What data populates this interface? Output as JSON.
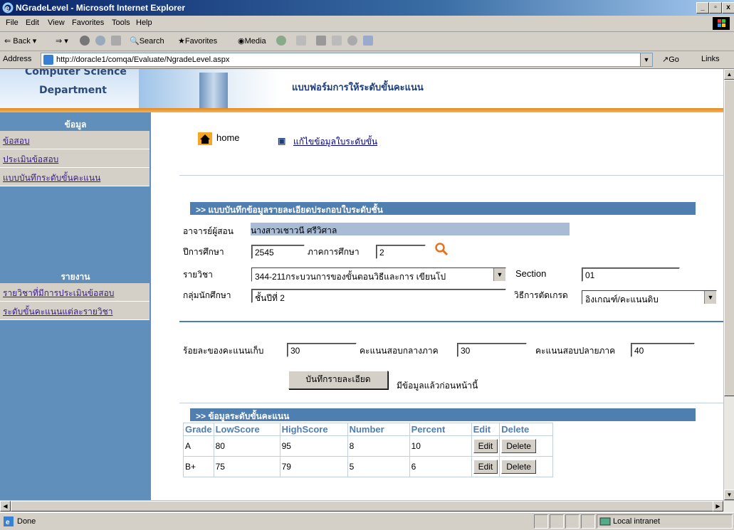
{
  "window": {
    "title": "NGradeLevel - Microsoft Internet Explorer"
  },
  "menu": [
    "File",
    "Edit",
    "View",
    "Favorites",
    "Tools",
    "Help"
  ],
  "toolbar": {
    "back": "Back",
    "search": "Search",
    "favorites": "Favorites",
    "media": "Media"
  },
  "address": {
    "label": "Address",
    "url": "http://doracle1/comqa/Evaluate/NgradeLevel.aspx",
    "go": "Go",
    "links": "Links"
  },
  "header": {
    "dept_line1": "Computer Science",
    "dept_line2": "Department",
    "title": "แบบฟอร์มการให้ระดับขั้นคะแนน"
  },
  "nav": {
    "section1": "ข้อมูล",
    "items1": [
      "ข้อสอบ",
      "ประเมินข้อสอบ",
      "แบบบันทึกระดับขั้นคะแนน"
    ],
    "section2": "รายงาน",
    "items2": [
      "รายวิชาที่มีการประเมินข้อสอบ",
      "ระดับขั้นคะแนนแต่ละรายวิชา"
    ]
  },
  "main": {
    "home": "home",
    "edit_link": "แก้ไขข้อมูลใบระดับขั้น",
    "section1_title": ">> แบบบันทึกข้อมูลรายละเอียดประกอบใบระดับชั้น",
    "teacher_label": "อาจารย์ผู้สอน",
    "teacher_value": "นางสาวเชาวนี ศรีวิศาล",
    "year_label": "ปีการศึกษา",
    "year_value": "2545",
    "term_label": "ภาคการศึกษา",
    "term_value": "2",
    "course_label": "รายวิชา",
    "course_value": "344-211กระบวนการของขั้นตอนวิธีและการ เขียนโป",
    "section_label": "Section",
    "section_value": "01",
    "group_label": "กลุ่มนักศึกษา",
    "group_value": "ชั้นปีที่ 2",
    "method_label": "วิธีการตัดเกรด",
    "method_value": "อิงเกณฑ์/คะแนนดิบ",
    "pct_label": "ร้อยละของคะแนนเก็บ",
    "pct_value": "30",
    "mid_label": "คะแนนสอบกลางภาค",
    "mid_value": "30",
    "final_label": "คะแนนสอบปลายภาค",
    "final_value": "40",
    "save_button": "บันทึกรายละเอียด",
    "save_note": "มีข้อมูลแล้วก่อนหน้านี้",
    "section2_title": ">> ข้อมูลระดับขั้นคะแนน",
    "table": {
      "headers": [
        "Grade",
        "LowScore",
        "HighScore",
        "Number",
        "Percent",
        "Edit",
        "Delete"
      ],
      "rows": [
        [
          "A",
          "80",
          "95",
          "8",
          "10",
          "Edit",
          "Delete"
        ],
        [
          "B+",
          "75",
          "79",
          "5",
          "6",
          "Edit",
          "Delete"
        ]
      ]
    }
  },
  "status": {
    "left": "Done",
    "zone": "Local intranet"
  }
}
